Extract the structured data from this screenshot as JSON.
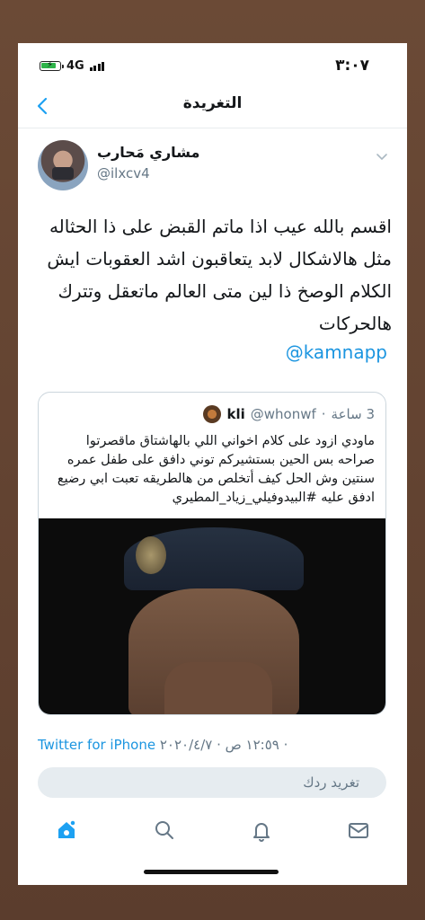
{
  "status_bar": {
    "time": "٣:٠٧",
    "network": "4G",
    "battery_level": 0.85
  },
  "nav": {
    "title": "التغريدة",
    "back_icon": "chevron-left-icon"
  },
  "tweet": {
    "author_name": "مشاري مَحارب",
    "author_handle": "@ilxcv4",
    "text": "اقسم بالله عيب اذا ماتم القبض على ذا الحثاله مثل هالاشكال لابد يتعاقبون اشد العقوبات ايش الكلام الوصخ ذا لين متى العالم ماتعقل وتترك هالحركات",
    "mention": "@kamnapp",
    "source": "Twitter for iPhone",
    "separator": "·",
    "timestamp": "١٢:٥٩ ص · ٢٠٢٠/٤/٧"
  },
  "quoted_tweet": {
    "name": "kli",
    "handle": "@whonwf",
    "separator": "·",
    "time": "3 ساعة",
    "text": "ماودي ازود على كلام اخواني اللي بالهاشتاق ماقصرتوا صراحه بس الحين بستشيركم توني دافق على طفل عمره سنتين وش الحل كيف أتخلص من هالطريقه تعبت ابي رضيع ادفق عليه #البيدوفيلي_زياد_المطيري"
  },
  "reply": {
    "placeholder": "تغريد ردك"
  },
  "tabbar": {
    "items": [
      {
        "icon": "home-icon",
        "active": true
      },
      {
        "icon": "search-icon",
        "active": false
      },
      {
        "icon": "bell-icon",
        "active": false
      },
      {
        "icon": "mail-icon",
        "active": false
      }
    ]
  },
  "colors": {
    "accent": "#1da1f2",
    "link": "#1b95e0",
    "text": "#14171a",
    "secondary": "#657786",
    "reply_bg": "#e6ecf0"
  }
}
